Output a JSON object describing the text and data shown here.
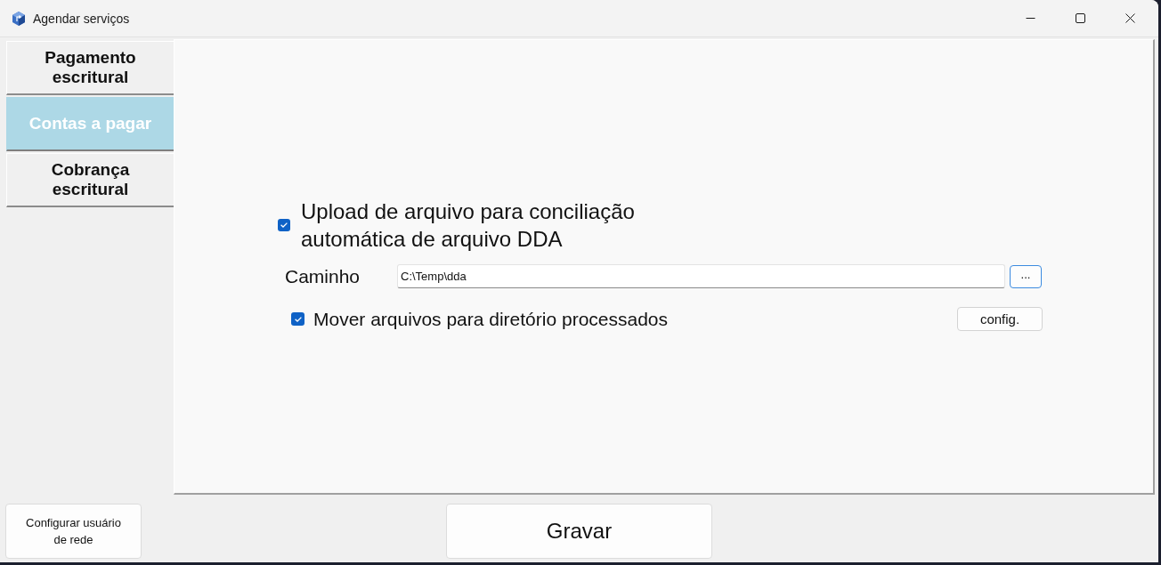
{
  "window": {
    "title": "Agendar serviços"
  },
  "tabs": [
    {
      "label": "Pagamento escritural",
      "selected": false
    },
    {
      "label": "Contas a pagar",
      "selected": true
    },
    {
      "label": "Cobrança escritural",
      "selected": false
    }
  ],
  "upload": {
    "label": "Upload de arquivo para conciliação automática de arquivo DDA",
    "checked": true
  },
  "path": {
    "label": "Caminho",
    "value": "C:\\Temp\\dda",
    "browse_button": "..."
  },
  "move_files": {
    "label": "Mover arquivos para diretório processados",
    "checked": true,
    "config_button": "config."
  },
  "footer": {
    "network_user_button": "Configurar usuário de rede",
    "save_button": "Gravar"
  }
}
